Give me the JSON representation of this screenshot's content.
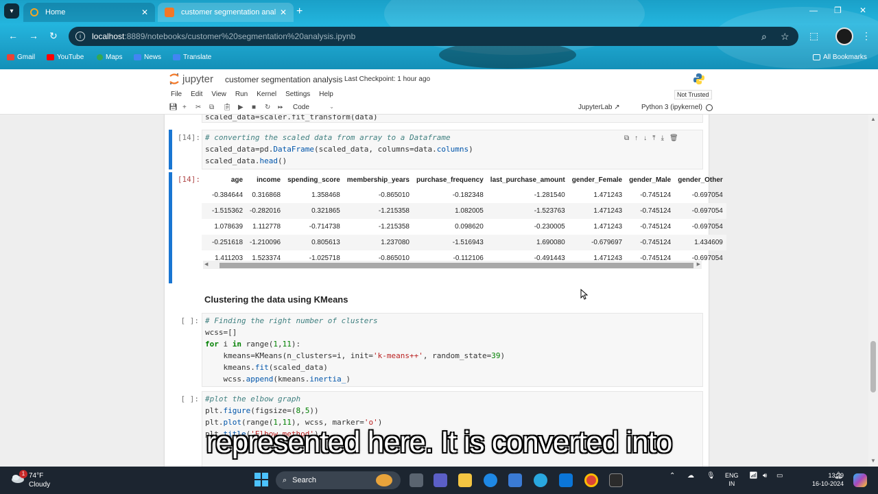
{
  "browser": {
    "tabs": [
      {
        "title": "Home",
        "active": false
      },
      {
        "title": "customer segmentation analysis",
        "active": true
      }
    ],
    "url_host": "localhost",
    "url_path": ":8889/notebooks/customer%20segmentation%20analysis.ipynb",
    "bookmarks": [
      "Gmail",
      "YouTube",
      "Maps",
      "News",
      "Translate"
    ],
    "all_bookmarks": "All Bookmarks"
  },
  "jupyter": {
    "logo_text": "jupyter",
    "notebook_name": "customer segmentation analysis",
    "checkpoint": "Last Checkpoint: 1 hour ago",
    "menu": [
      "File",
      "Edit",
      "View",
      "Run",
      "Kernel",
      "Settings",
      "Help"
    ],
    "trust": "Not Trusted",
    "cell_type": "Code",
    "jupyterlab_link": "JupyterLab",
    "kernel": "Python 3 (ipykernel)"
  },
  "cells": {
    "partial_line": "scaled_data=scaler.fit_transform(data)",
    "cell14": {
      "prompt": "[14]:",
      "line1": "# converting the scaled data from array to a Dataframe",
      "line2a": "scaled_data=pd.",
      "line2b": "DataFrame",
      "line2c": "(scaled_data, columns=data.",
      "line2d": "columns",
      "line2e": ")",
      "line3a": "scaled_data.",
      "line3b": "head",
      "line3c": "()"
    },
    "out14": {
      "prompt": "[14]:",
      "columns": [
        "",
        "age",
        "income",
        "spending_score",
        "membership_years",
        "purchase_frequency",
        "last_purchase_amount",
        "gender_Female",
        "gender_Male",
        "gender_Other"
      ],
      "rows": [
        [
          "-0.384644",
          "0.316868",
          "1.358468",
          "-0.865010",
          "-0.182348",
          "-1.281540",
          "1.471243",
          "-0.745124",
          "-0.697054"
        ],
        [
          "-1.515362",
          "-0.282016",
          "0.321865",
          "-1.215358",
          "1.082005",
          "-1.523763",
          "1.471243",
          "-0.745124",
          "-0.697054"
        ],
        [
          "1.078639",
          "1.112778",
          "-0.714738",
          "-1.215358",
          "0.098620",
          "-0.230005",
          "1.471243",
          "-0.745124",
          "-0.697054"
        ],
        [
          "-0.251618",
          "-1.210096",
          "0.805613",
          "1.237080",
          "-1.516943",
          "1.690080",
          "-0.679697",
          "-0.745124",
          "1.434609"
        ],
        [
          "1.411203",
          "1.523374",
          "-1.025718",
          "-0.865010",
          "-0.112106",
          "-0.491443",
          "1.471243",
          "-0.745124",
          "-0.697054"
        ]
      ]
    },
    "markdown_heading": "Clustering the data using KMeans",
    "cell_kmeans": {
      "prompt": "[ ]:",
      "comment": "# Finding the right number of clusters",
      "l2": "wcss=[]",
      "l3_for": "for",
      "l3_i": " i ",
      "l3_in": "in",
      "l3_rest_a": " range(",
      "l3_n1": "1",
      "l3_comma": ",",
      "l3_n2": "11",
      "l3_rest_b": "):",
      "l4a": "    kmeans=KMeans(n_clusters=i, init=",
      "l4_str": "'k-means++'",
      "l4b": ", random_state=",
      "l4_num": "39",
      "l4c": ")",
      "l5a": "    kmeans.",
      "l5_fn": "fit",
      "l5b": "(scaled_data)",
      "l6a": "    wcss.",
      "l6_fn": "append",
      "l6b": "(kmeans.",
      "l6_attr": "inertia_",
      "l6c": ")"
    },
    "cell_plot": {
      "prompt": "[ ]:",
      "comment": "#plot the elbow graph",
      "l2a": "plt.",
      "l2_fn": "figure",
      "l2b": "(figsize=(",
      "l2_n1": "8",
      "l2_c": ",",
      "l2_n2": "5",
      "l2c": "))",
      "l3a": "plt.",
      "l3_fn": "plot",
      "l3b": "(range(",
      "l3_n1": "1",
      "l3_c": ",",
      "l3_n2": "11",
      "l3c": "), wcss, marker=",
      "l3_str": "'o'",
      "l3d": ")",
      "l4a": "plt.",
      "l4_fn": "title",
      "l4b": "(",
      "l4_str": "'Elbow method'",
      "l4c": ")"
    }
  },
  "caption": "represented here. It is converted into",
  "taskbar": {
    "temp": "74°F",
    "weather": "Cloudy",
    "badge": "1",
    "search": "Search",
    "lang1": "ENG",
    "lang2": "IN",
    "time": "13:39",
    "date": "16-10-2024"
  },
  "colors": {
    "accent": "#1976d2",
    "taskbar": "#1c2530",
    "output_prompt": "#b04747"
  }
}
